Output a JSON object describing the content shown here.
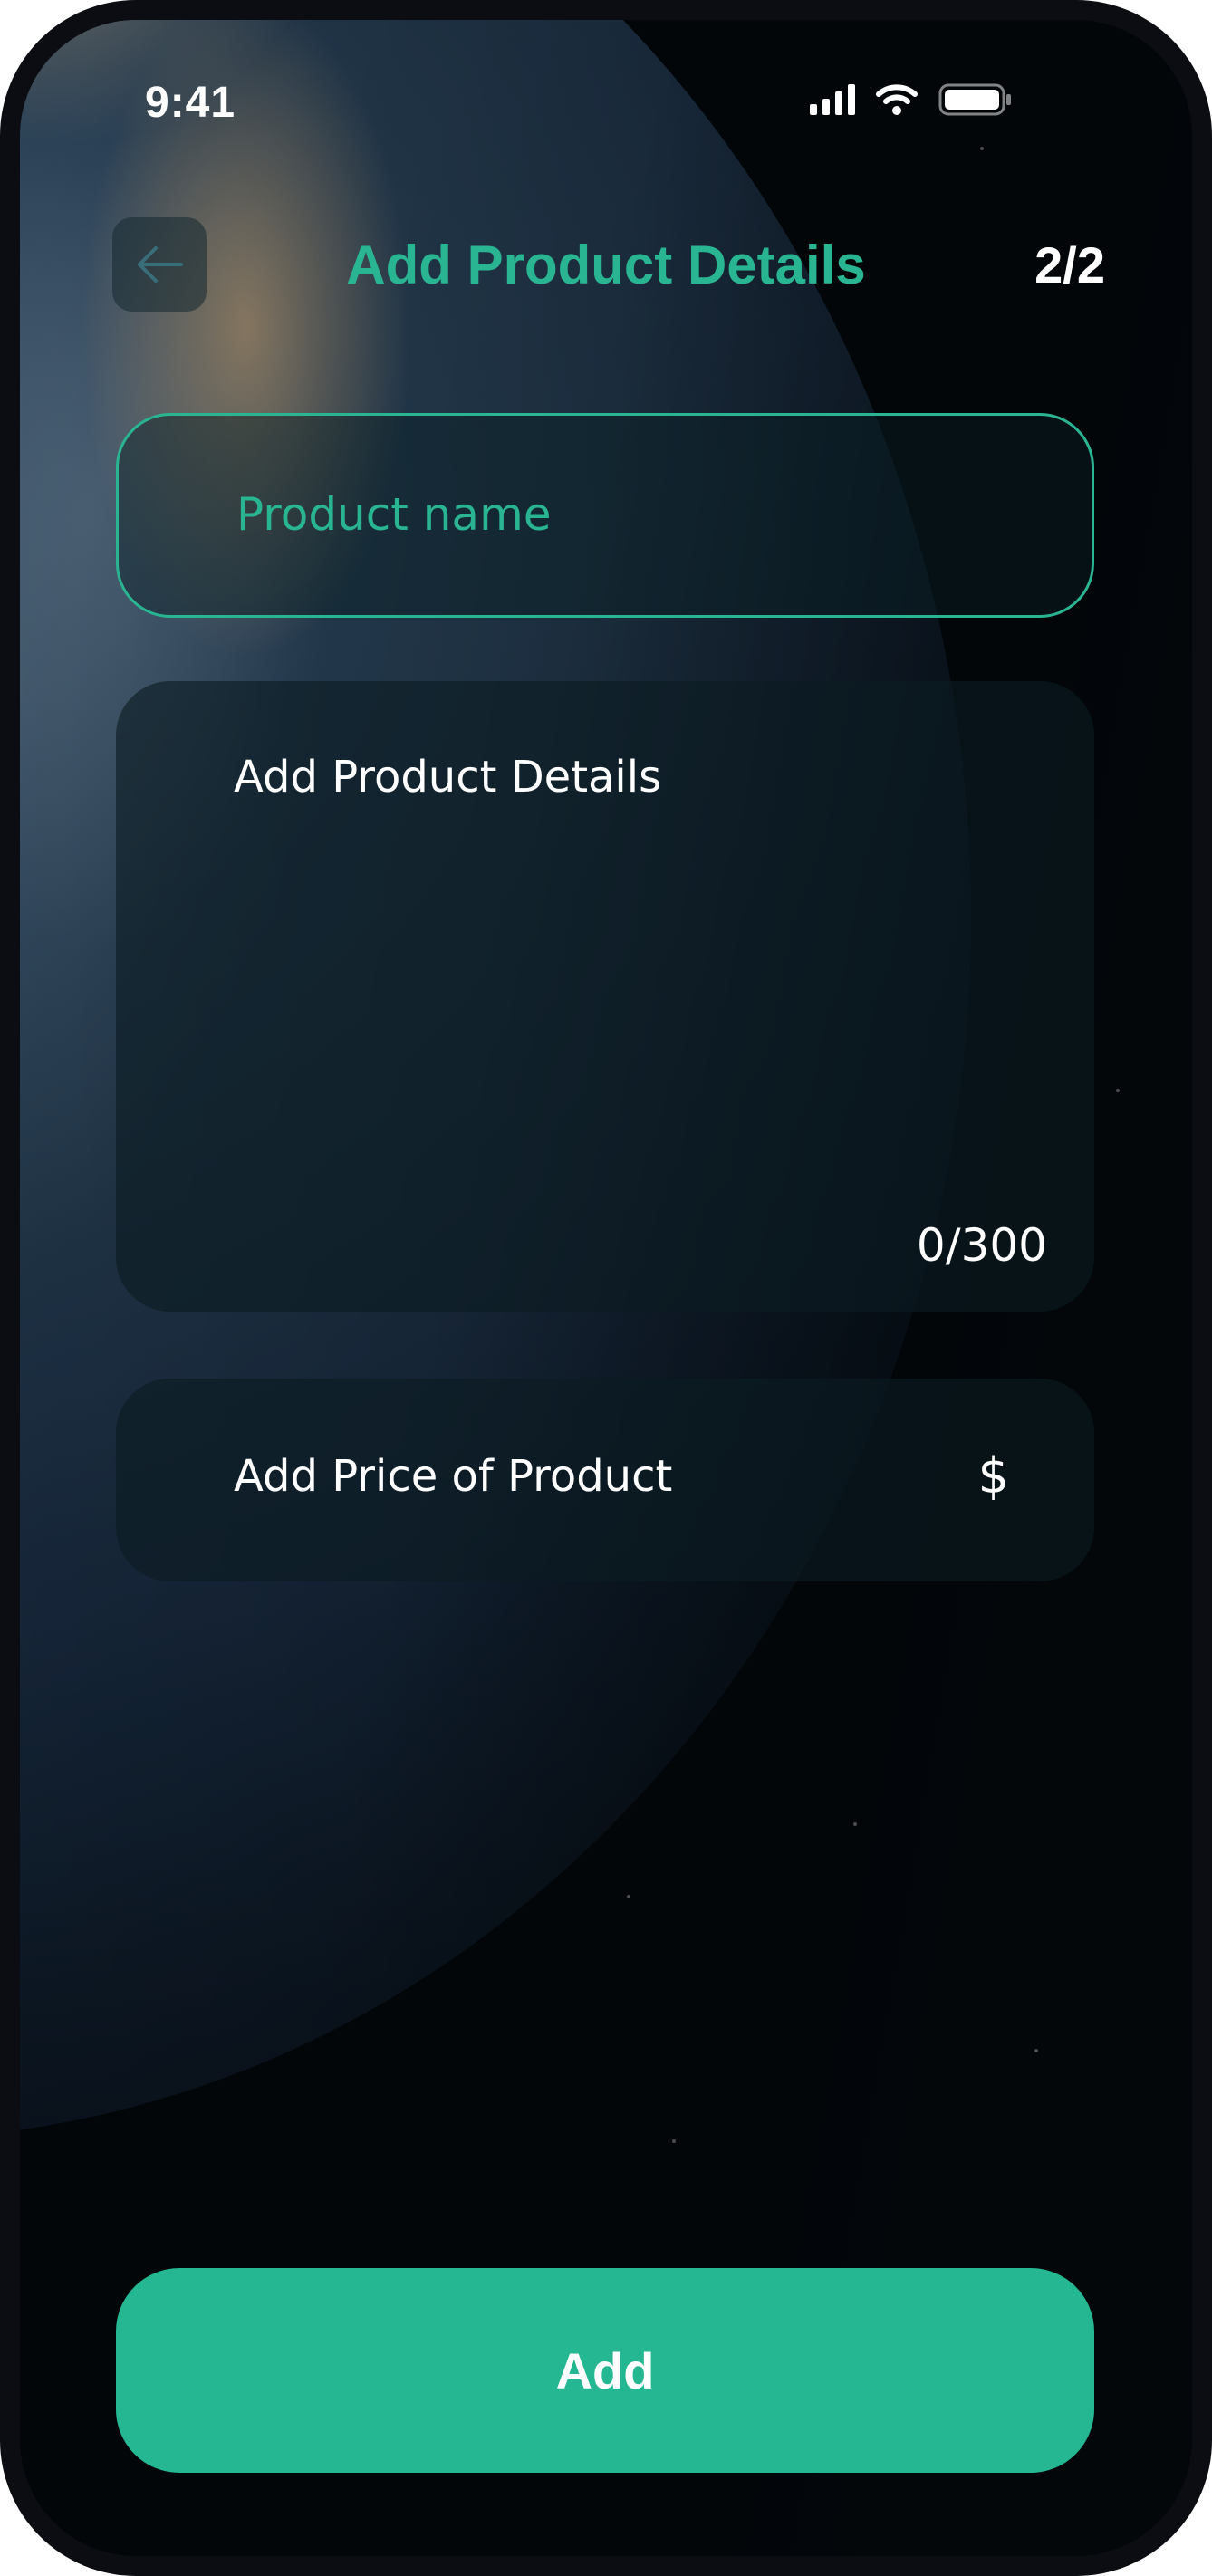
{
  "status_bar": {
    "time": "9:41",
    "icons": [
      "cellular-signal-icon",
      "wifi-icon",
      "battery-icon"
    ]
  },
  "header": {
    "back_icon": "arrow-left-icon",
    "title": "Add Product Details",
    "step": "2/2"
  },
  "form": {
    "product_name": {
      "placeholder": "Product name",
      "value": ""
    },
    "details": {
      "placeholder": "Add Product Details",
      "value": "",
      "counter": "0/300"
    },
    "price": {
      "placeholder": "Add Price of Product",
      "currency": "$",
      "value": ""
    }
  },
  "actions": {
    "add_label": "Add"
  },
  "colors": {
    "accent": "#2ab592",
    "button": "#24b791",
    "background": "#03070a"
  }
}
